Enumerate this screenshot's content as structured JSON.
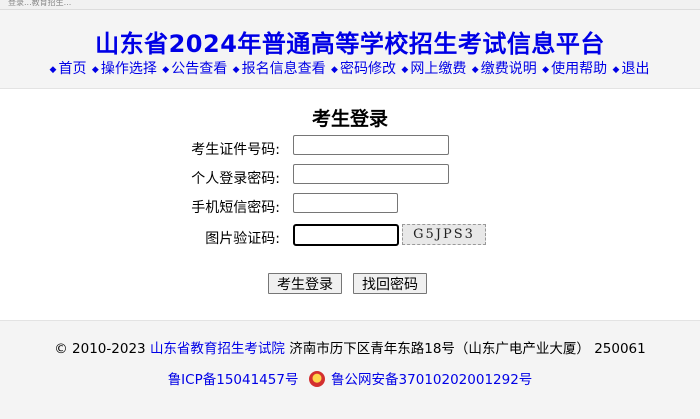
{
  "browser": {
    "tab_text": "登录...教育招生..."
  },
  "header": {
    "title": "山东省2024年普通高等学校招生考试信息平台",
    "nav": [
      {
        "label": "首页"
      },
      {
        "label": "操作选择"
      },
      {
        "label": "公告查看"
      },
      {
        "label": "报名信息查看"
      },
      {
        "label": "密码修改"
      },
      {
        "label": "网上缴费"
      },
      {
        "label": "缴费说明"
      },
      {
        "label": "使用帮助"
      },
      {
        "label": "退出"
      }
    ]
  },
  "login": {
    "title": "考生登录",
    "fields": {
      "id": {
        "label": "考生证件号码:",
        "value": ""
      },
      "password": {
        "label": "个人登录密码:",
        "value": ""
      },
      "sms": {
        "label": "手机短信密码:",
        "value": ""
      },
      "captcha": {
        "label": "图片验证码:",
        "value": "",
        "image_text": "G5JPS3"
      }
    },
    "buttons": {
      "login": "考生登录",
      "recover": "找回密码"
    }
  },
  "footer": {
    "copyright_prefix": "© 2010-2023",
    "org_link": "山东省教育招生考试院",
    "address": "济南市历下区青年东路18号（山东广电产业大厦） 250061",
    "icp": "鲁ICP备15041457号",
    "police": "鲁公网安备37010202001292号"
  },
  "colors": {
    "link": "#0000e6",
    "header_bg": "#f4f4f4"
  }
}
